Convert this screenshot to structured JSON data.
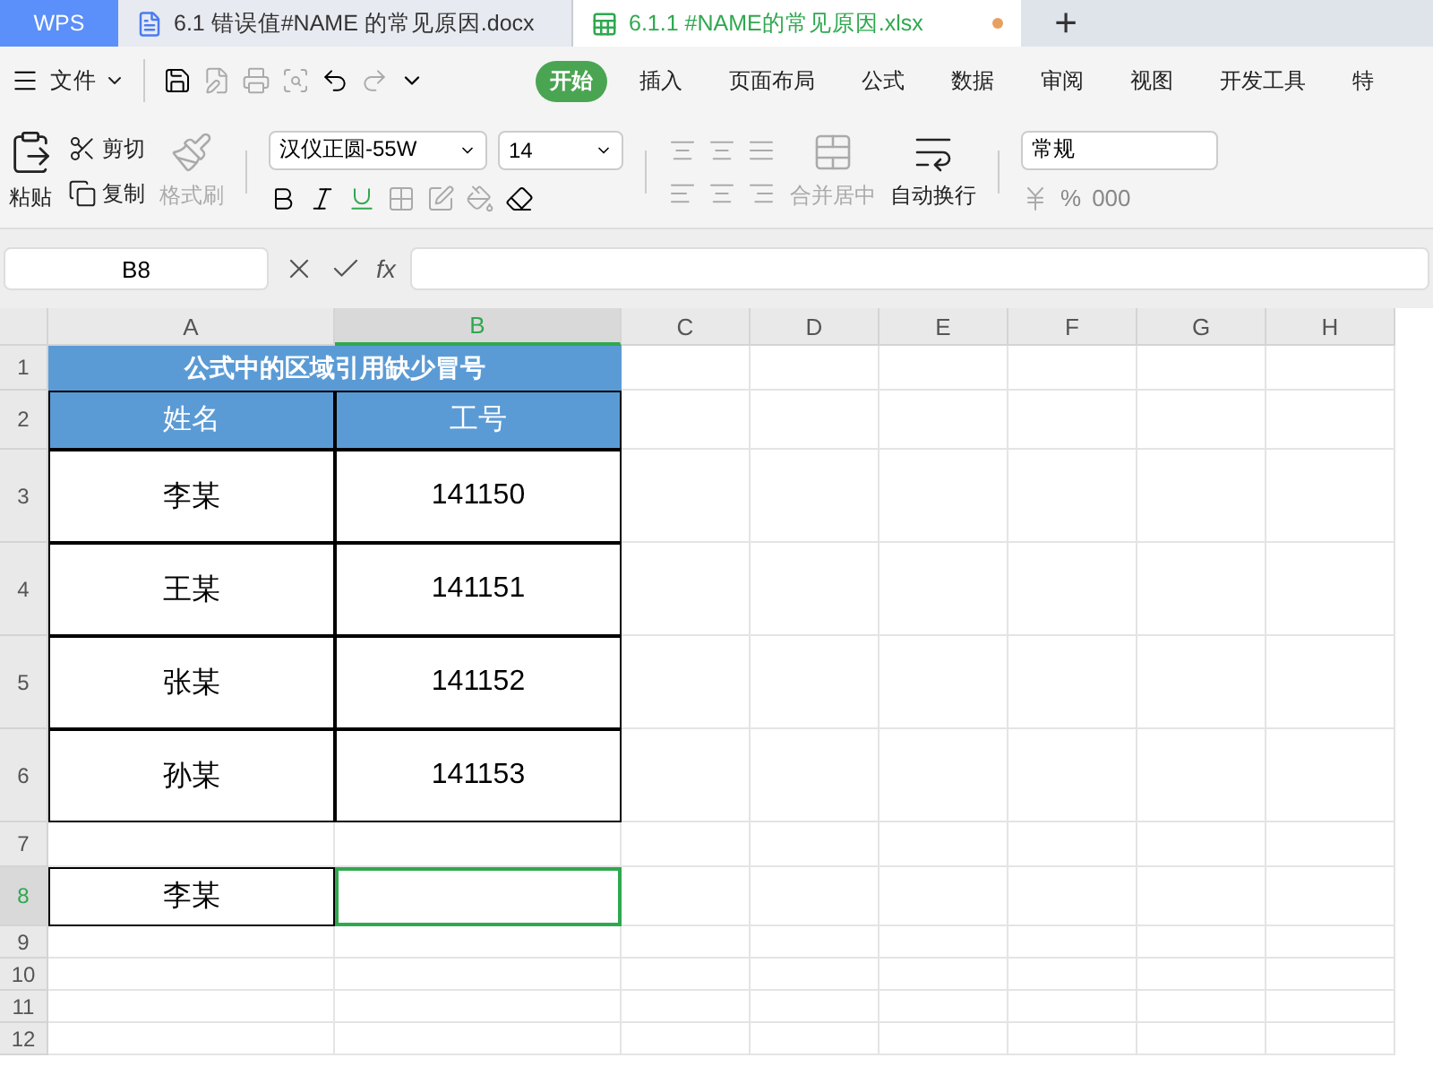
{
  "app_tabs": [
    {
      "label": "WPS",
      "kind": "home",
      "selected": false
    },
    {
      "label": "6.1 错误值#NAME 的常见原因.docx",
      "kind": "doc",
      "selected": false
    },
    {
      "label": "6.1.1 #NAME的常见原因.xlsx",
      "kind": "sheet",
      "selected": true,
      "modified": true
    }
  ],
  "new_tab": "+",
  "file_menu": "文件",
  "menu_tabs": [
    {
      "label": "开始",
      "selected": true
    },
    {
      "label": "插入",
      "selected": false
    },
    {
      "label": "页面布局",
      "selected": false
    },
    {
      "label": "公式",
      "selected": false
    },
    {
      "label": "数据",
      "selected": false
    },
    {
      "label": "审阅",
      "selected": false
    },
    {
      "label": "视图",
      "selected": false
    },
    {
      "label": "开发工具",
      "selected": false
    },
    {
      "label": "特",
      "selected": false
    }
  ],
  "ribbon": {
    "paste": "粘贴",
    "cut": "剪切",
    "copy": "复制",
    "format_painter": {
      "label": "格式刷",
      "disabled": true
    },
    "font": "汉仪正圆-55W",
    "font_size": "14",
    "merge": {
      "label": "合并居中",
      "disabled": true
    },
    "wrap": {
      "label": "自动换行",
      "disabled": false
    },
    "number_format": "常规",
    "percent": "%",
    "thousands": "000"
  },
  "formula_bar": {
    "cell_ref": "B8",
    "fx": "fx"
  },
  "sheet": {
    "columns": [
      {
        "label": "A",
        "selected": false
      },
      {
        "label": "B",
        "selected": true
      },
      {
        "label": "C",
        "selected": false
      },
      {
        "label": "D",
        "selected": false
      },
      {
        "label": "E",
        "selected": false
      },
      {
        "label": "F",
        "selected": false
      },
      {
        "label": "G",
        "selected": false
      },
      {
        "label": "H",
        "selected": false
      }
    ],
    "rows": [
      {
        "number": "1",
        "kind": "short",
        "selected": false,
        "cells": [
          {
            "kind": "title",
            "text": "公式中的区域引用缺少冒号",
            "selected": false
          }
        ]
      },
      {
        "number": "2",
        "kind": "medium",
        "selected": false,
        "cells": [
          {
            "kind": "header",
            "text": "姓名",
            "selected": false
          },
          {
            "kind": "header",
            "text": "工号",
            "selected": false
          }
        ]
      },
      {
        "number": "3",
        "kind": "tall",
        "selected": false,
        "cells": [
          {
            "kind": "data",
            "text": "李某",
            "selected": false
          },
          {
            "kind": "data",
            "text": "141150",
            "selected": false
          }
        ]
      },
      {
        "number": "4",
        "kind": "tall",
        "selected": false,
        "cells": [
          {
            "kind": "data",
            "text": "王某",
            "selected": false
          },
          {
            "kind": "data",
            "text": "141151",
            "selected": false
          }
        ]
      },
      {
        "number": "5",
        "kind": "tall",
        "selected": false,
        "cells": [
          {
            "kind": "data",
            "text": "张某",
            "selected": false
          },
          {
            "kind": "data",
            "text": "141152",
            "selected": false
          }
        ]
      },
      {
        "number": "6",
        "kind": "tall",
        "selected": false,
        "cells": [
          {
            "kind": "data",
            "text": "孙某",
            "selected": false
          },
          {
            "kind": "data",
            "text": "141153",
            "selected": false
          }
        ]
      },
      {
        "number": "7",
        "kind": "short",
        "selected": false,
        "cells": []
      },
      {
        "number": "8",
        "kind": "medium",
        "selected": true,
        "cells": [
          {
            "kind": "data",
            "text": "李某",
            "selected": false
          },
          {
            "kind": "data",
            "selected": true
          }
        ]
      },
      {
        "number": "9",
        "kind": "small",
        "selected": false,
        "cells": []
      },
      {
        "number": "10",
        "kind": "small",
        "selected": false,
        "cells": []
      },
      {
        "number": "11",
        "kind": "small",
        "selected": false,
        "cells": []
      },
      {
        "number": "12",
        "kind": "small",
        "selected": false,
        "cells": []
      }
    ]
  }
}
